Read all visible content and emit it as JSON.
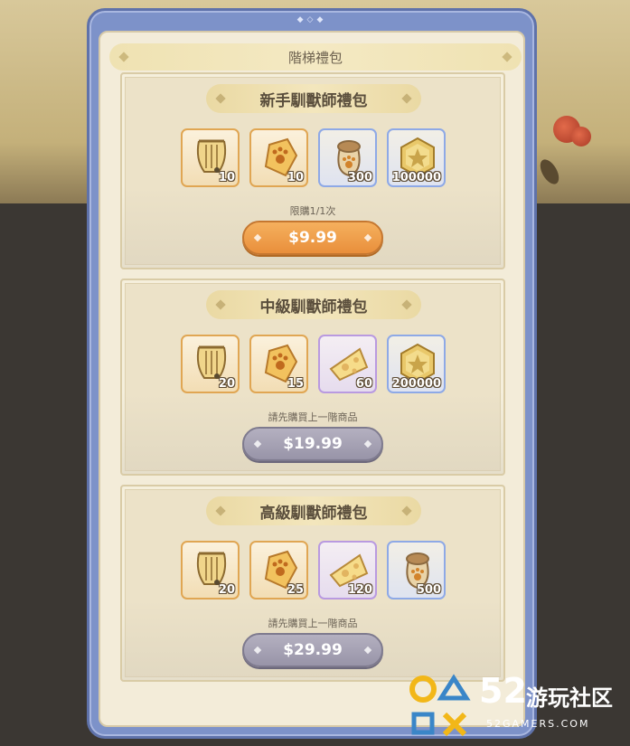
{
  "panel_title": "階梯禮包",
  "packs": [
    {
      "title": "新手馴獸師禮包",
      "items": [
        {
          "icon": "lyre-icon",
          "qty": "10",
          "rarity": "orange"
        },
        {
          "icon": "paw-gem-icon",
          "qty": "10",
          "rarity": "orange"
        },
        {
          "icon": "paw-sack-icon",
          "qty": "300",
          "rarity": "blue"
        },
        {
          "icon": "gold-coin-icon",
          "qty": "100000",
          "rarity": "blue"
        }
      ],
      "note": "限購1/1次",
      "price": "$9.99",
      "button_state": "orange"
    },
    {
      "title": "中級馴獸師禮包",
      "items": [
        {
          "icon": "lyre-icon",
          "qty": "20",
          "rarity": "orange"
        },
        {
          "icon": "paw-gem-icon",
          "qty": "15",
          "rarity": "orange"
        },
        {
          "icon": "cheese-icon",
          "qty": "60",
          "rarity": "purple"
        },
        {
          "icon": "gold-coin-icon",
          "qty": "200000",
          "rarity": "blue"
        }
      ],
      "note": "請先購買上一階商品",
      "price": "$19.99",
      "button_state": "gray"
    },
    {
      "title": "高級馴獸師禮包",
      "items": [
        {
          "icon": "lyre-icon",
          "qty": "20",
          "rarity": "orange"
        },
        {
          "icon": "paw-gem-icon",
          "qty": "25",
          "rarity": "orange"
        },
        {
          "icon": "cheese-icon",
          "qty": "120",
          "rarity": "purple"
        },
        {
          "icon": "paw-sack-icon",
          "qty": "500",
          "rarity": "blue"
        }
      ],
      "note": "請先購買上一階商品",
      "price": "$29.99",
      "button_state": "gray"
    }
  ],
  "watermark": {
    "number": "52",
    "name": "游玩社区",
    "site": "52GAMERS.COM"
  },
  "colors": {
    "frame": "#7d92c9",
    "panel": "#f3ecd9",
    "price_active": "#ee9c48",
    "price_locked": "#a6a2b4",
    "rarity_orange": "#e0a653",
    "rarity_blue": "#8ea9e6",
    "rarity_purple": "#b99ae0"
  }
}
